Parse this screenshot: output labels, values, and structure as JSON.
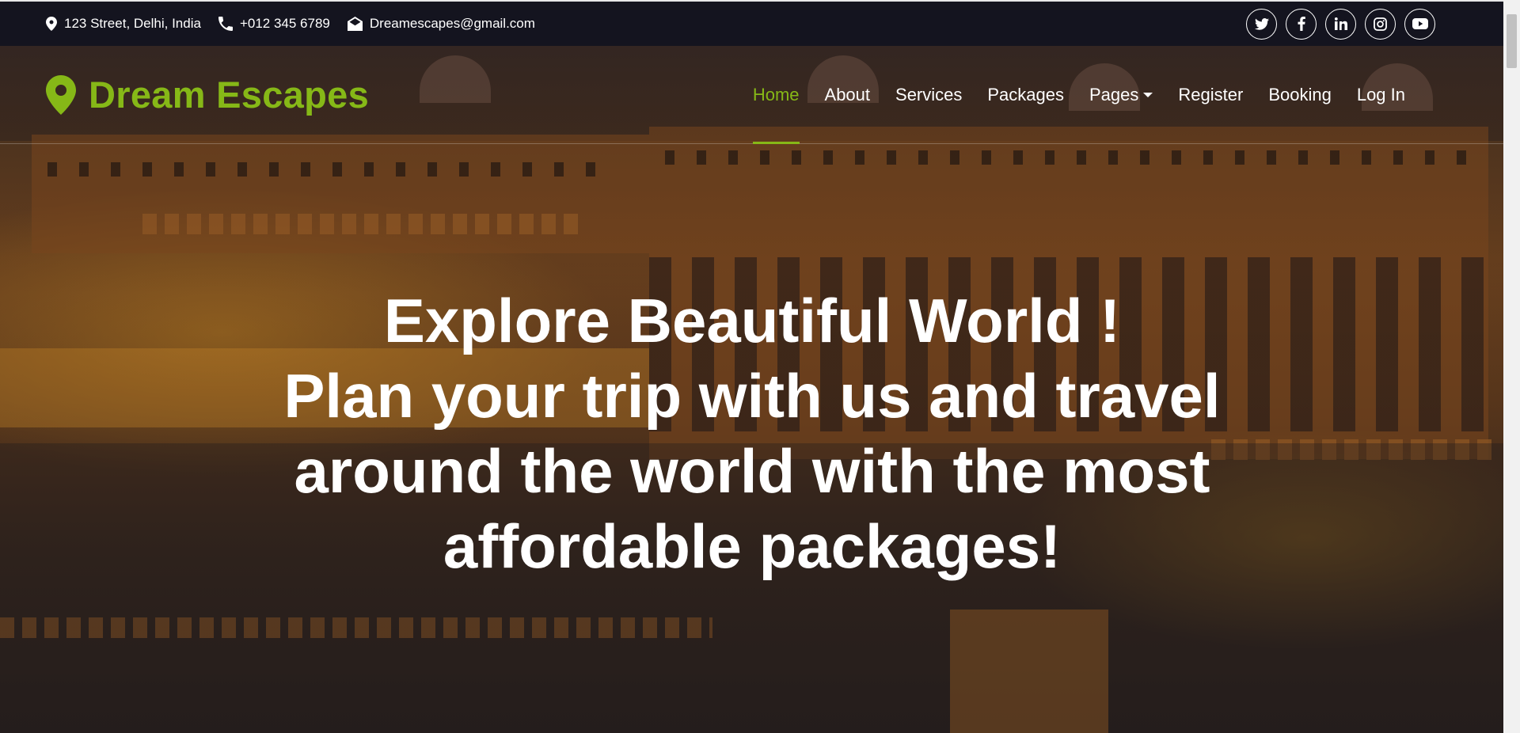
{
  "topbar": {
    "address": "123 Street, Delhi, India",
    "phone": "+012 345 6789",
    "email": "Dreamescapes@gmail.com",
    "socials": [
      "twitter-icon",
      "facebook-icon",
      "linkedin-icon",
      "instagram-icon",
      "youtube-icon"
    ]
  },
  "navbar": {
    "brand": "Dream Escapes",
    "items": [
      {
        "label": "Home",
        "active": true
      },
      {
        "label": "About"
      },
      {
        "label": "Services"
      },
      {
        "label": "Packages"
      },
      {
        "label": "Pages",
        "dropdown": true
      },
      {
        "label": "Register"
      },
      {
        "label": "Booking"
      },
      {
        "label": "Log In"
      }
    ]
  },
  "hero": {
    "lines": [
      "Explore Beautiful World !",
      "Plan your trip with us and travel",
      "around the world with the most",
      "affordable packages!"
    ]
  },
  "colors": {
    "accent": "#86b817",
    "topbar_bg": "#14141f",
    "text": "#ffffff"
  }
}
